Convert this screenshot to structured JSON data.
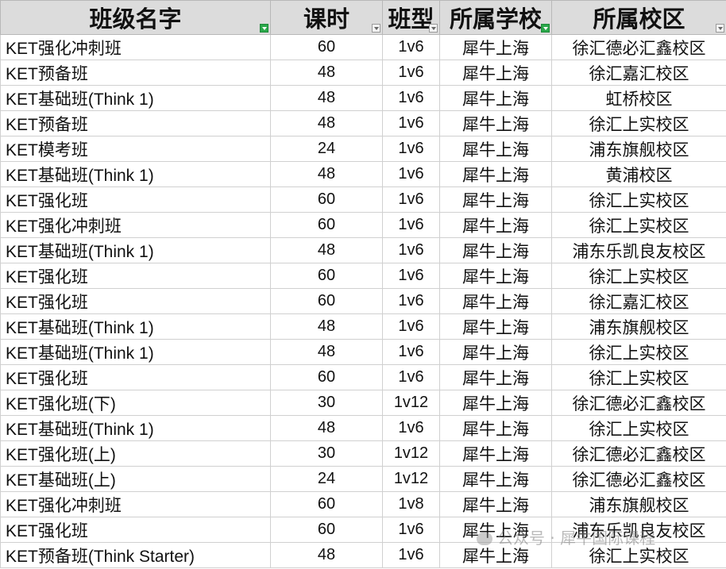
{
  "headers": [
    {
      "label": "班级名字",
      "filter_active": true
    },
    {
      "label": "课时",
      "filter_active": false
    },
    {
      "label": "班型",
      "filter_active": false
    },
    {
      "label": "所属学校",
      "filter_active": true
    },
    {
      "label": "所属校区",
      "filter_active": false
    }
  ],
  "rows": [
    {
      "name": "KET强化冲刺班",
      "hours": "60",
      "type": "1v6",
      "school": "犀牛上海",
      "campus": "徐汇德必汇鑫校区"
    },
    {
      "name": "KET预备班",
      "hours": "48",
      "type": "1v6",
      "school": "犀牛上海",
      "campus": "徐汇嘉汇校区"
    },
    {
      "name": "KET基础班(Think 1)",
      "hours": "48",
      "type": "1v6",
      "school": "犀牛上海",
      "campus": "虹桥校区"
    },
    {
      "name": "KET预备班",
      "hours": "48",
      "type": "1v6",
      "school": "犀牛上海",
      "campus": "徐汇上实校区"
    },
    {
      "name": "KET模考班",
      "hours": "24",
      "type": "1v6",
      "school": "犀牛上海",
      "campus": "浦东旗舰校区"
    },
    {
      "name": "KET基础班(Think 1)",
      "hours": "48",
      "type": "1v6",
      "school": "犀牛上海",
      "campus": "黄浦校区"
    },
    {
      "name": "KET强化班",
      "hours": "60",
      "type": "1v6",
      "school": "犀牛上海",
      "campus": "徐汇上实校区"
    },
    {
      "name": "KET强化冲刺班",
      "hours": "60",
      "type": "1v6",
      "school": "犀牛上海",
      "campus": "徐汇上实校区"
    },
    {
      "name": "KET基础班(Think 1)",
      "hours": "48",
      "type": "1v6",
      "school": "犀牛上海",
      "campus": "浦东乐凯良友校区"
    },
    {
      "name": "KET强化班",
      "hours": "60",
      "type": "1v6",
      "school": "犀牛上海",
      "campus": "徐汇上实校区"
    },
    {
      "name": "KET强化班",
      "hours": "60",
      "type": "1v6",
      "school": "犀牛上海",
      "campus": "徐汇嘉汇校区"
    },
    {
      "name": "KET基础班(Think 1)",
      "hours": "48",
      "type": "1v6",
      "school": "犀牛上海",
      "campus": "浦东旗舰校区"
    },
    {
      "name": "KET基础班(Think 1)",
      "hours": "48",
      "type": "1v6",
      "school": "犀牛上海",
      "campus": "徐汇上实校区"
    },
    {
      "name": "KET强化班",
      "hours": "60",
      "type": "1v6",
      "school": "犀牛上海",
      "campus": "徐汇上实校区"
    },
    {
      "name": "KET强化班(下)",
      "hours": "30",
      "type": "1v12",
      "school": "犀牛上海",
      "campus": "徐汇德必汇鑫校区"
    },
    {
      "name": "KET基础班(Think 1)",
      "hours": "48",
      "type": "1v6",
      "school": "犀牛上海",
      "campus": "徐汇上实校区"
    },
    {
      "name": "KET强化班(上)",
      "hours": "30",
      "type": "1v12",
      "school": "犀牛上海",
      "campus": "徐汇德必汇鑫校区"
    },
    {
      "name": "KET基础班(上)",
      "hours": "24",
      "type": "1v12",
      "school": "犀牛上海",
      "campus": "徐汇德必汇鑫校区"
    },
    {
      "name": "KET强化冲刺班",
      "hours": "60",
      "type": "1v8",
      "school": "犀牛上海",
      "campus": "浦东旗舰校区"
    },
    {
      "name": "KET强化班",
      "hours": "60",
      "type": "1v6",
      "school": "犀牛上海",
      "campus": "浦东乐凯良友校区"
    },
    {
      "name": "KET预备班(Think Starter)",
      "hours": "48",
      "type": "1v6",
      "school": "犀牛上海",
      "campus": "徐汇上实校区"
    }
  ],
  "watermark": "公众号 · 犀牛国际课程",
  "colors": {
    "header_bg": "#dcdcdc",
    "filter_active": "#2aa84a",
    "grid": "#d0d0d0"
  }
}
